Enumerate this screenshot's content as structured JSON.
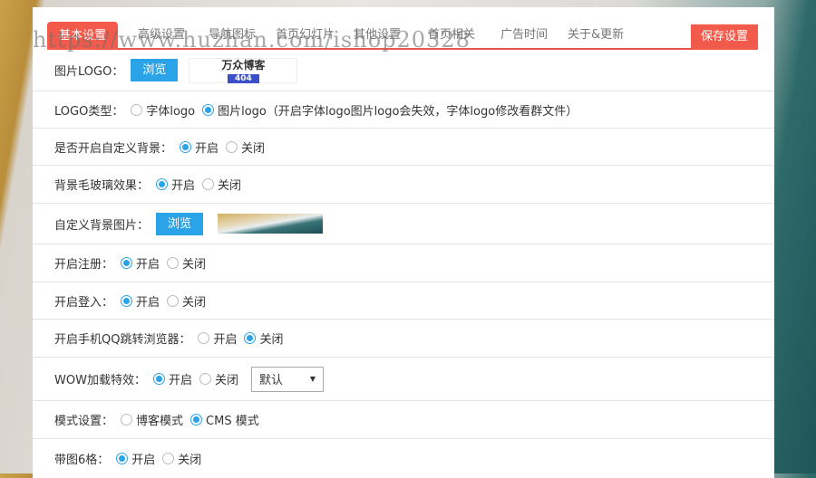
{
  "tabs": [
    "基本设置",
    "高级设置",
    "导航图标",
    "首页幻灯片",
    "其他设置",
    "首页相关",
    "广告时间",
    "关于&更新"
  ],
  "save_label": "保存设置",
  "watermark": "https://www.huzhan.com/ishop20328",
  "rows": {
    "logo": {
      "label": "图片LOGO：",
      "browse": "浏览",
      "logo_text": "万众博客",
      "logo_sub": "404"
    },
    "logo_type": {
      "label": "LOGO类型：",
      "opt1": "字体logo",
      "opt2": "图片logo（开启字体logo图片logo会失效，字体logo修改看群文件）"
    },
    "custom_bg": {
      "label": "是否开启自定义背景：",
      "on": "开启",
      "off": "关闭"
    },
    "blur": {
      "label": "背景毛玻璃效果：",
      "on": "开启",
      "off": "关闭"
    },
    "bg_image": {
      "label": "自定义背景图片：",
      "browse": "浏览"
    },
    "register": {
      "label": "开启注册：",
      "on": "开启",
      "off": "关闭"
    },
    "login": {
      "label": "开启登入：",
      "on": "开启",
      "off": "关闭"
    },
    "qq": {
      "label": "开启手机QQ跳转浏览器：",
      "on": "开启",
      "off": "关闭"
    },
    "wow": {
      "label": "WOW加载特效：",
      "on": "开启",
      "off": "关闭",
      "select": "默认"
    },
    "mode": {
      "label": "模式设置：",
      "opt1": "博客模式",
      "opt2": "CMS 模式"
    },
    "grid6": {
      "label": "带图6格：",
      "on": "开启",
      "off": "关闭"
    }
  }
}
